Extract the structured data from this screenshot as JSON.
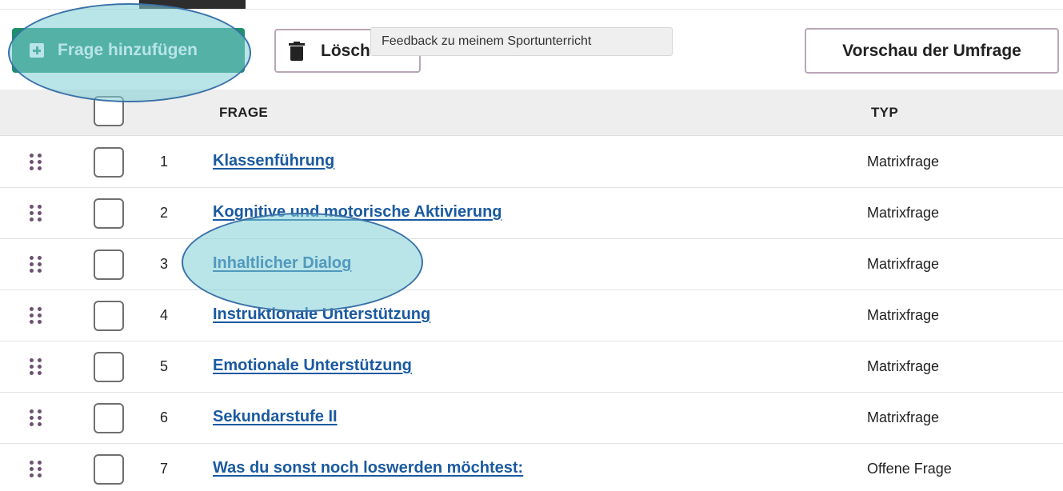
{
  "toolbar": {
    "add_question_label": "Frage hinzufügen",
    "delete_label": "Löschen",
    "preview_label": "Vorschau der Umfrage"
  },
  "tooltip": {
    "text": "Feedback zu meinem Sportunterricht"
  },
  "table": {
    "headers": {
      "question": "FRAGE",
      "type": "TYP"
    },
    "rows": [
      {
        "num": "1",
        "question": "Klassenführung",
        "type": "Matrixfrage"
      },
      {
        "num": "2",
        "question": "Kognitive und motorische Aktivierung",
        "type": "Matrixfrage"
      },
      {
        "num": "3",
        "question": "Inhaltlicher Dialog",
        "type": "Matrixfrage"
      },
      {
        "num": "4",
        "question": "Instruktionale Unterstützung",
        "type": "Matrixfrage"
      },
      {
        "num": "5",
        "question": "Emotionale Unterstützung",
        "type": "Matrixfrage"
      },
      {
        "num": "6",
        "question": "Sekundarstufe II",
        "type": "Matrixfrage"
      },
      {
        "num": "7",
        "question": "Was du sonst noch loswerden möchtest:",
        "type": "Offene Frage"
      }
    ]
  },
  "colors": {
    "primary_green": "#1e8e6b",
    "link_blue": "#1a5aa0",
    "drag_handle": "#6e4e73",
    "highlight_fill": "#7fcdd6"
  },
  "icons": {
    "add": "plus-square-icon",
    "delete": "trash-icon",
    "drag": "drag-handle-icon"
  }
}
